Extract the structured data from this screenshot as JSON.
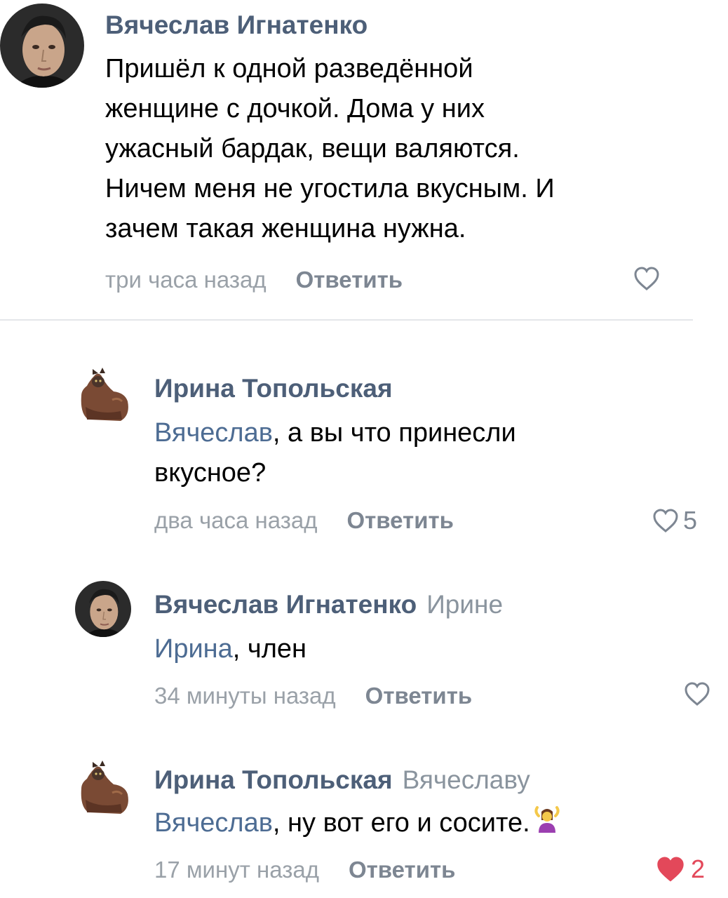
{
  "colors": {
    "author": "#4d5f78",
    "mention": "#4d6c93",
    "time": "#9aa1a8",
    "reply_button": "#7d8692",
    "like_active": "#e3485a",
    "divider": "#e4e6ea"
  },
  "comments": [
    {
      "author": "Вячеслав Игнатенко",
      "reply_to": "",
      "mention": "",
      "lines": [
        "Пришёл к одной разведённой",
        "женщине с дочкой. Дома у них",
        "ужасный бардак, вещи валяются.",
        "Ничем меня не угостила вкусным. И",
        "зачем такая женщина нужна."
      ],
      "time": "три часа назад",
      "reply_label": "Ответить",
      "like_icon": "heart-outline-icon",
      "likes": ""
    },
    {
      "author": "Ирина Топольская",
      "reply_to": "",
      "mention": "Вячеслав",
      "lines": [
        ", а вы что принесли",
        "вкусное?"
      ],
      "time": "два часа назад",
      "reply_label": "Ответить",
      "like_icon": "heart-outline-icon",
      "likes": "5"
    },
    {
      "author": "Вячеслав Игнатенко",
      "reply_to": "Ирине",
      "mention": "Ирина",
      "lines": [
        ", член"
      ],
      "time": "34 минуты назад",
      "reply_label": "Ответить",
      "like_icon": "heart-outline-icon",
      "likes": ""
    },
    {
      "author": "Ирина Топольская",
      "reply_to": "Вячеславу",
      "mention": "Вячеслав",
      "lines": [
        ", ну вот его и сосите."
      ],
      "emoji": "person-shrugging-emoji",
      "time": "17 минут назад",
      "reply_label": "Ответить",
      "like_icon": "heart-filled-icon",
      "likes": "2"
    }
  ]
}
